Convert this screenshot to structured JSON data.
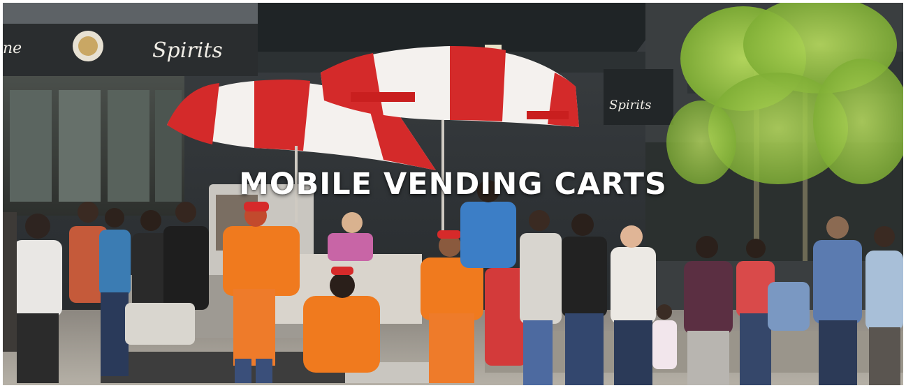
{
  "headline": "MOBILE VENDING CARTS",
  "store_signs": {
    "left_fragment": "ne",
    "spirits": "Spirits",
    "right_sign": "Spirits"
  },
  "colors": {
    "umbrella_red": "#d42a2a",
    "umbrella_white": "#f4f1ee",
    "vendor_orange": "#f07a1e",
    "awning_dark": "#2a2d2f",
    "tree_green": "#9fc94a",
    "headline": "#ffffff"
  }
}
